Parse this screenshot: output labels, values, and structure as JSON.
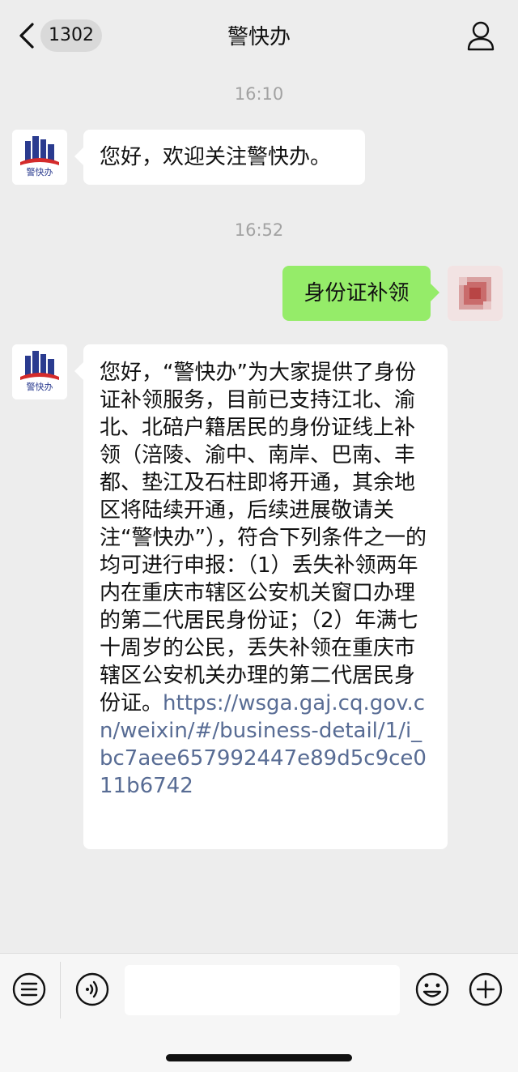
{
  "header": {
    "back_icon": "chevron-left-icon",
    "unread_count": "1302",
    "title": "警快办",
    "profile_icon": "person-icon"
  },
  "chat": {
    "messages": [
      {
        "type": "time",
        "text": "16:10"
      },
      {
        "type": "incoming",
        "sender": "警快办",
        "text": "您好，欢迎关注警快办。"
      },
      {
        "type": "time",
        "text": "16:52"
      },
      {
        "type": "outgoing",
        "text": "身份证补领"
      },
      {
        "type": "incoming",
        "sender": "警快办",
        "text": "您好，“警快办”为大家提供了身份证补领服务，目前已支持江北、渝北、北碚户籍居民的身份证线上补领（涪陵、渝中、南岸、巴南、丰都、垫江及石柱即将开通，其余地区将陆续开通，后续进展敬请关注“警快办”），符合下列条件之一的均可进行申报：（1）丢失补领两年内在重庆市辖区公安机关窗口办理的第二代居民身份证；（2）年满七十周岁的公民，丢失补领在重庆市辖区公安机关办理的第二代居民身份证。",
        "link": "https://wsga.gaj.cq.gov.cn/weixin/#/business-detail/1/i_bc7aee657992447e89d5c9ce011b6742"
      }
    ]
  },
  "input_bar": {
    "menu_icon": "menu-list-icon",
    "voice_icon": "voice-icon",
    "emoji_icon": "emoji-icon",
    "plus_icon": "plus-icon",
    "input_value": ""
  },
  "colors": {
    "background": "#ededed",
    "outgoing_bubble": "#95ec69",
    "incoming_bubble": "#ffffff",
    "link": "#586c94"
  }
}
